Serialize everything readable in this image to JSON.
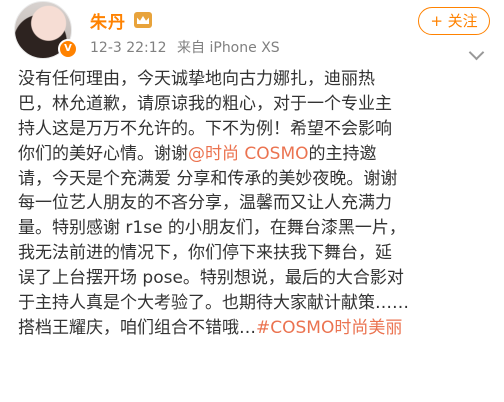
{
  "post": {
    "username": "朱丹",
    "time": "12-3 22:12",
    "source": "来自 iPhone XS",
    "follow_label": "+ 关注",
    "vip_badge": "V",
    "avatar_icon": "user-avatar",
    "lines": [
      [
        "没有任何理由，今天诚挚地向古力娜扎，迪丽热"
      ],
      [
        "巴，林允道歉，请原谅我的粗心，对于一个专业主"
      ],
      [
        "持人这是万万不允许的。下不为例！希望不会影响"
      ],
      [
        "你们的美好心情。谢谢",
        "@时尚 COSMO",
        "的主持邀"
      ],
      [
        "请，今天是个充满爱 分享和传承的美妙夜晚。谢谢"
      ],
      [
        "每一位艺人朋友的不吝分享，温馨而又让人充满力"
      ],
      [
        "量。特别感谢 r1se 的小朋友们，在舞台漆黑一片，"
      ],
      [
        "我无法前进的情况下，你们停下来扶我下舞台，延"
      ],
      [
        "误了上台摆开场 pose。特别想说，最后的大合影对"
      ],
      [
        "于主持人真是个大考验了。也期待大家献计献策……"
      ],
      [
        "搭档王耀庆，咱们组合不错哦…",
        "#COSMO时尚美丽"
      ]
    ]
  },
  "colors": {
    "accent": "#ff8200",
    "link": "#eb7350",
    "meta": "#808080",
    "text": "#333333"
  }
}
